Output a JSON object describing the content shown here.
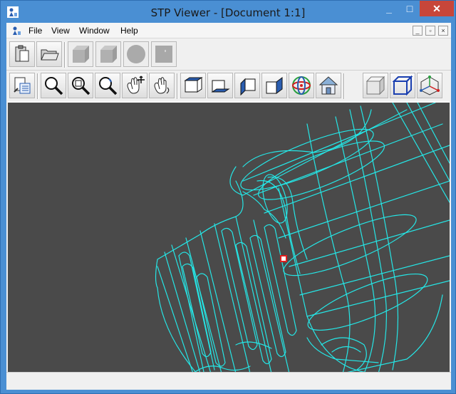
{
  "window": {
    "title": "STP Viewer - [Document 1:1]",
    "minimize": "_",
    "maximize": "□",
    "close": "✕"
  },
  "menu": {
    "items": [
      "File",
      "View",
      "Window",
      "Help"
    ],
    "mdi_minimize": "_",
    "mdi_restore": "▫",
    "mdi_close": "×"
  },
  "toolbar1": {
    "buttons": [
      "paste-icon",
      "open-folder-icon",
      "box-solid-icon",
      "box-solid-alt-icon",
      "sphere-icon",
      "cube-face-icon"
    ]
  },
  "toolbar2": {
    "buttons": [
      "document-list-icon",
      "zoom-icon",
      "zoom-window-icon",
      "zoom-undo-icon",
      "pan-move-icon",
      "rotate-hand-icon",
      "view-top-icon",
      "view-bottom-icon",
      "view-left-icon",
      "view-right-icon",
      "view-axo-icon",
      "home-icon",
      "shaded-icon",
      "wireframe-icon",
      "axes-icon"
    ]
  },
  "colors": {
    "wireframe": "#25e6e6",
    "viewport_bg": "#4a4a4a",
    "title_bg": "#4a8fd3",
    "close_bg": "#c7463a",
    "marker": "#e02020"
  },
  "status": {
    "text": ""
  }
}
